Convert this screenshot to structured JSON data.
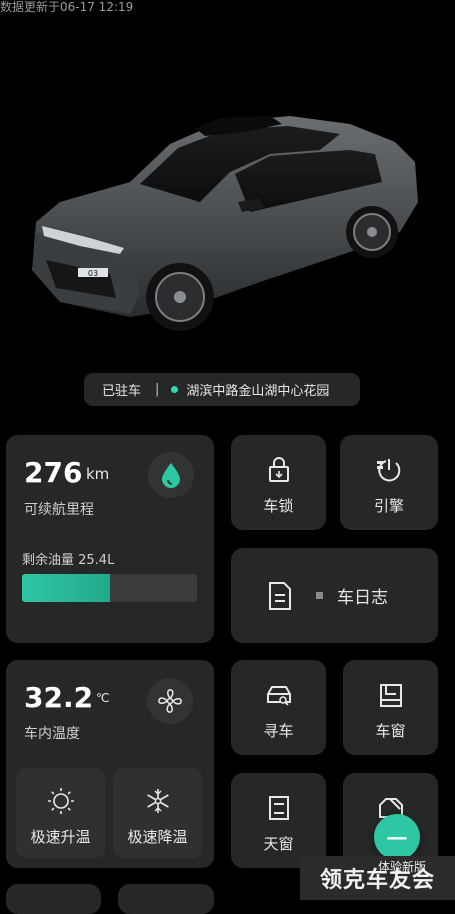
{
  "status": {
    "update_text": "数据更新于06-17 12:19"
  },
  "car": {
    "badge": "03"
  },
  "location": {
    "parked_label": "已驻车",
    "separator": "|",
    "address": "湖滨中路金山湖中心花园"
  },
  "range_card": {
    "value": "276",
    "unit": "km",
    "label": "可续航里程",
    "fuel_label": "剩余油量 25.4L",
    "fuel_fraction": 0.5
  },
  "tiles": {
    "lock": "车锁",
    "engine": "引擎",
    "log": "车日志",
    "find": "寻车",
    "window": "车窗",
    "sunroof": "天窗",
    "trunk": "后"
  },
  "temp_card": {
    "value": "32.2",
    "unit": "℃",
    "label": "车内温度",
    "heat_label": "极速升温",
    "cool_label": "极速降温"
  },
  "fab": {
    "symbol": "一"
  },
  "banner": {
    "text": "领克车友会",
    "overlay": "体验新版"
  },
  "colors": {
    "accent": "#2fc6a4",
    "card": "#262828",
    "background": "#000000"
  }
}
